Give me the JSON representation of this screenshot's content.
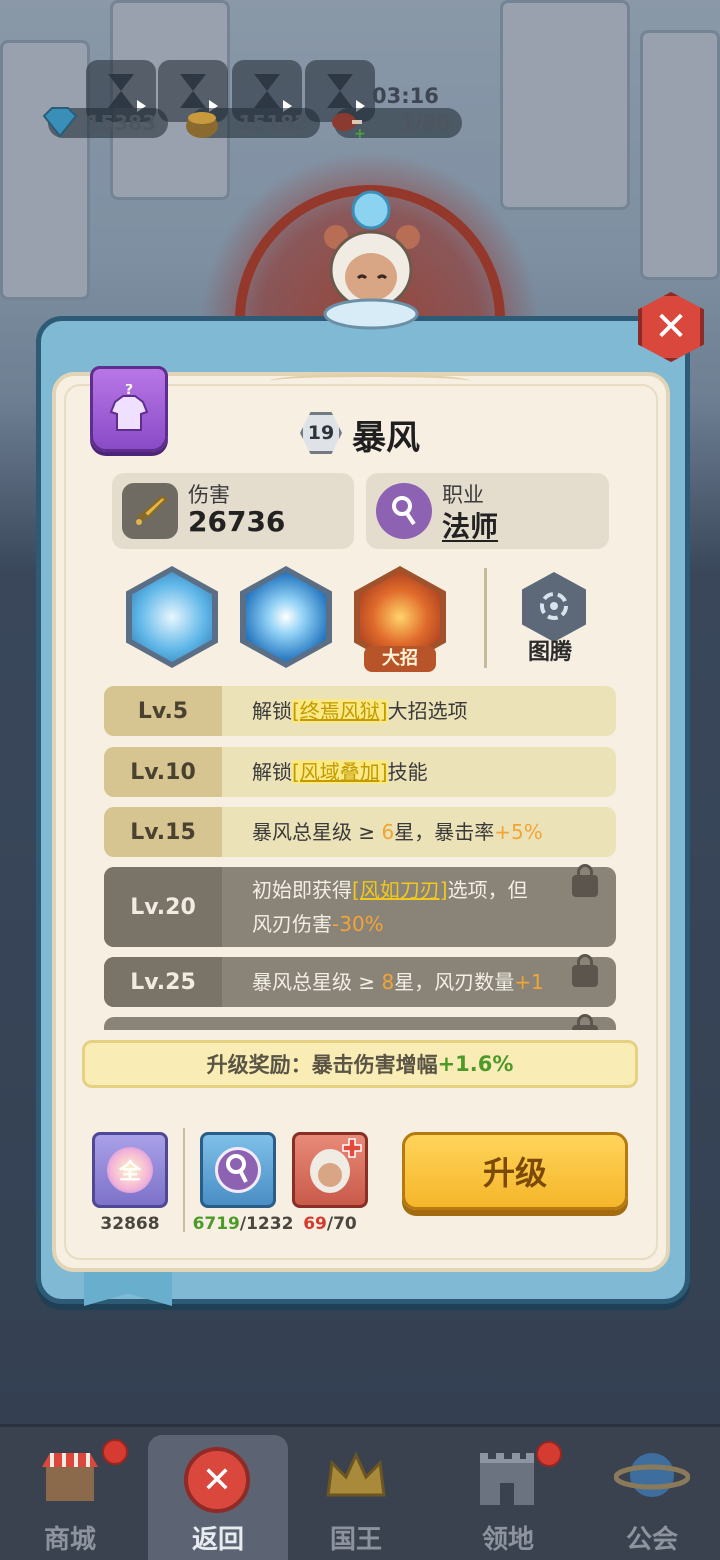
{
  "hud": {
    "gems": "15383",
    "coins": "15182",
    "meat": "1/80",
    "timer": "03:16"
  },
  "hero": {
    "level": "19",
    "name": "暴风",
    "damage_label": "伤害",
    "damage_value": "26736",
    "class_label": "职业",
    "class_value": "法师"
  },
  "skills": {
    "ult_tag": "大招",
    "totem_label": "图腾"
  },
  "unlocks": [
    {
      "level": "Lv.5",
      "text_before": "解锁",
      "highlight": "[终焉风狱]",
      "text_after": "大招选项",
      "bonus": "",
      "line2": "",
      "locked": false
    },
    {
      "level": "Lv.10",
      "text_before": "解锁",
      "highlight": "[风域叠加]",
      "text_after": "技能",
      "bonus": "",
      "line2": "",
      "locked": false
    },
    {
      "level": "Lv.15",
      "text_before": "暴风总星级 ≥ ",
      "highlight": "",
      "num": "6",
      "text_after": "星，暴击率",
      "bonus": "+5%",
      "line2": "",
      "locked": false
    },
    {
      "level": "Lv.20",
      "text_before": "初始即获得",
      "highlight": "[风如刀刃]",
      "text_after": "选项，但",
      "line2": "风刃伤害",
      "bonus": "-30%",
      "locked": true
    },
    {
      "level": "Lv.25",
      "text_before": "暴风总星级 ≥ ",
      "highlight": "",
      "num": "8",
      "text_after": "星，风刃数量",
      "bonus": "+1",
      "line2": "",
      "locked": true
    }
  ],
  "reward": {
    "label": "升级奖励：暴击伤害增幅",
    "bonus": "+1.6%"
  },
  "costs": {
    "universal_icon_text": "全",
    "universal_count": "32868",
    "class_have": "6719",
    "class_need": "/1232",
    "shard_have": "69",
    "shard_need": "/70"
  },
  "upgrade_button": "升级",
  "nav": {
    "shop": "商城",
    "back": "返回",
    "king": "国王",
    "territory": "领地",
    "guild": "公会"
  },
  "colors": {
    "accent": "#f5b62a",
    "positive": "#4d9a2a",
    "negative": "#d33b2f",
    "highlight": "#f0c81e"
  }
}
